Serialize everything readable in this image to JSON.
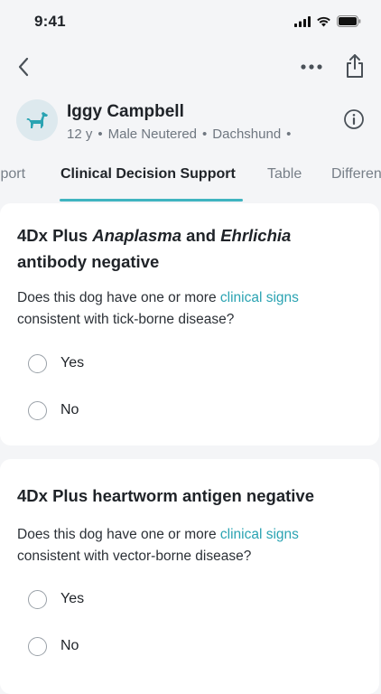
{
  "status": {
    "time": "9:41"
  },
  "patient": {
    "name": "Iggy Campbell",
    "age": "12 y",
    "sex": "Male Neutered",
    "breed": "Dachshund",
    "avatar_icon": "dog-icon",
    "accent_color": "#2aa3b2"
  },
  "tabs": [
    {
      "label": "Report"
    },
    {
      "label": "Clinical Decision Support"
    },
    {
      "label": "Table"
    },
    {
      "label": "Differentials"
    }
  ],
  "cards": [
    {
      "title_part1": "4Dx Plus ",
      "title_em1": "Anaplasma",
      "title_part2": " and ",
      "title_em2": "Ehrlichia",
      "title_part3": " antibody negative",
      "question_prefix": "Does this dog have one or more ",
      "question_link": "clinical signs",
      "question_suffix": " consistent with tick-borne disease?",
      "options": [
        "Yes",
        "No"
      ]
    },
    {
      "title": "4Dx Plus heartworm antigen negative",
      "question_prefix": "Does this dog have one or more ",
      "question_link": "clinical signs",
      "question_suffix": " consistent with vector-borne disease?",
      "options": [
        "Yes",
        "No"
      ]
    }
  ]
}
